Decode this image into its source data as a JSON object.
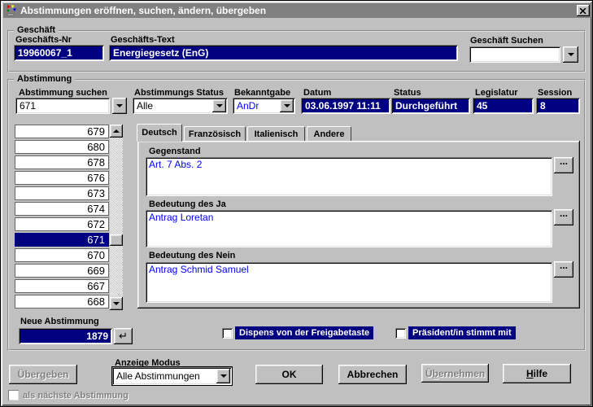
{
  "window": {
    "title": "Abstimmungen eröffnen, suchen, ändern, übergeben"
  },
  "icons": {
    "more": "...",
    "enter": "↵"
  },
  "geschaeft": {
    "legend": "Geschäft",
    "nr_label": "Geschäfts-Nr",
    "nr_value": "19960067_1",
    "text_label": "Geschäfts-Text",
    "text_value": "Energiegesetz (EnG)",
    "suchen_label": "Geschäft Suchen",
    "suchen_value": ""
  },
  "abstimmung": {
    "legend": "Abstimmung",
    "suchen_label": "Abstimmung suchen",
    "suchen_value": "671",
    "status_filter_label": "Abstimmungs Status",
    "status_filter_value": "Alle",
    "bekanntgabe_label": "Bekanntgabe",
    "bekanntgabe_value": "AnDr",
    "datum_label": "Datum",
    "datum_value": "03.06.1997 11:11",
    "status_label": "Status",
    "status_value": "Durchgeführt",
    "legislatur_label": "Legislatur",
    "legislatur_value": "45",
    "session_label": "Session",
    "session_value": "8",
    "list_items": [
      "679",
      "680",
      "678",
      "676",
      "673",
      "674",
      "672",
      "671",
      "670",
      "669",
      "667",
      "668"
    ],
    "selected_item": "671",
    "tabs": [
      "Deutsch",
      "Französisch",
      "Italienisch",
      "Andere"
    ],
    "active_tab": "Deutsch",
    "gegenstand_label": "Gegenstand",
    "gegenstand_value": "Art. 7 Abs. 2",
    "ja_label": "Bedeutung des Ja",
    "ja_value": "Antrag Loretan",
    "nein_label": "Bedeutung des Nein",
    "nein_value": "Antrag Schmid Samuel",
    "neue_label": "Neue Abstimmung",
    "neue_value": "1879",
    "dispens_label": "Dispens von der Freigabetaste",
    "praesident_label": "Präsident/in stimmt mit"
  },
  "footer": {
    "uebergeben_label": "Übergeben",
    "anzeige_label": "Anzeige Modus",
    "anzeige_value": "Alle Abstimmungen",
    "ok_label": "OK",
    "abbrechen_label": "Abbrechen",
    "uebernehmen_label": "Übernehmen",
    "hilfe_label": "Hilfe",
    "naechste_label": "als nächste Abstimmung"
  },
  "colors": {
    "face": "#c0c0c0",
    "titlebar": "#808080",
    "navy": "#000080",
    "blue_text": "#0000ff"
  }
}
